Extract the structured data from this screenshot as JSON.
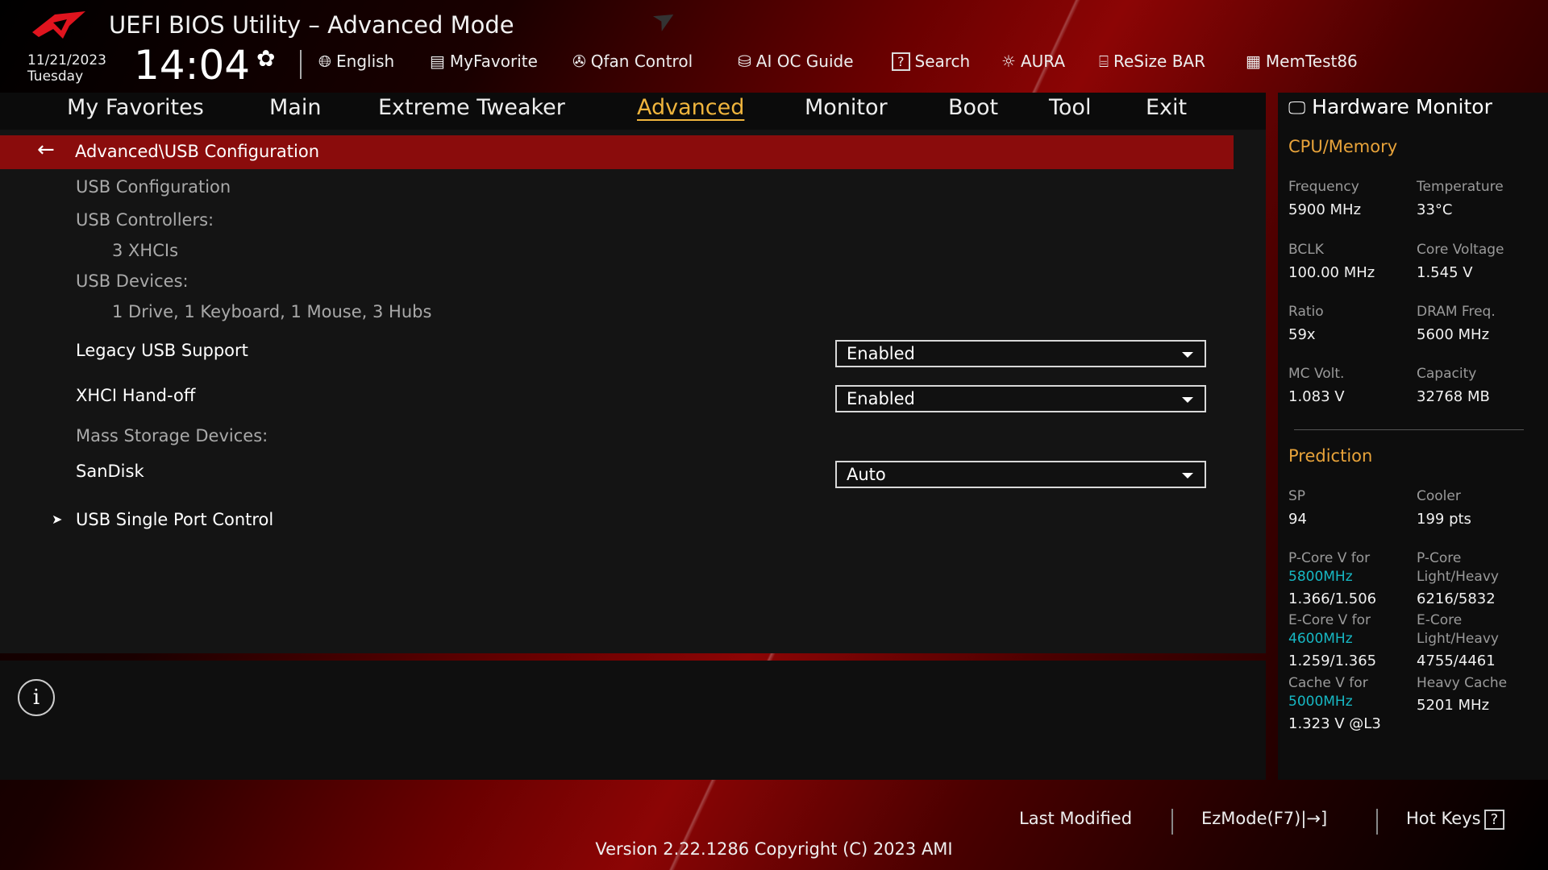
{
  "header": {
    "title": "UEFI BIOS Utility – Advanced Mode",
    "date": "11/21/2023",
    "day": "Tuesday",
    "time": "14:04"
  },
  "toolbar": [
    {
      "label": "English",
      "icon": "globe-icon"
    },
    {
      "label": "MyFavorite",
      "icon": "favorite-list-icon"
    },
    {
      "label": "Qfan Control",
      "icon": "fan-icon"
    },
    {
      "label": "AI OC Guide",
      "icon": "ai-chip-icon"
    },
    {
      "label": "Search",
      "icon": "question-box-icon"
    },
    {
      "label": "AURA",
      "icon": "aura-light-icon"
    },
    {
      "label": "ReSize BAR",
      "icon": "gpu-card-icon"
    },
    {
      "label": "MemTest86",
      "icon": "memory-icon"
    }
  ],
  "tabs": [
    "My Favorites",
    "Main",
    "Extreme Tweaker",
    "Advanced",
    "Monitor",
    "Boot",
    "Tool",
    "Exit"
  ],
  "active_tab": "Advanced",
  "breadcrumb": "Advanced\\USB Configuration",
  "items": {
    "usb_config": "USB Configuration",
    "controllers_label": "USB Controllers:",
    "controllers_value": "3 XHCIs",
    "devices_label": "USB Devices:",
    "devices_value": "1 Drive, 1 Keyboard, 1 Mouse, 3 Hubs",
    "legacy": {
      "label": "Legacy USB Support",
      "value": "Enabled"
    },
    "xhci": {
      "label": "XHCI Hand-off",
      "value": "Enabled"
    },
    "mass_label": "Mass Storage Devices:",
    "sandisk": {
      "label": "SanDisk",
      "value": "Auto"
    },
    "single_port": "USB Single Port Control"
  },
  "hw": {
    "title": "Hardware Monitor",
    "cpu_section": "CPU/Memory",
    "cpu": [
      {
        "label": "Frequency",
        "value": "5900 MHz"
      },
      {
        "label": "Temperature",
        "value": "33°C"
      },
      {
        "label": "BCLK",
        "value": "100.00 MHz"
      },
      {
        "label": "Core Voltage",
        "value": "1.545 V"
      },
      {
        "label": "Ratio",
        "value": "59x"
      },
      {
        "label": "DRAM Freq.",
        "value": "5600 MHz"
      },
      {
        "label": "MC Volt.",
        "value": "1.083 V"
      },
      {
        "label": "Capacity",
        "value": "32768 MB"
      }
    ],
    "pred_section": "Prediction",
    "sp": {
      "label": "SP",
      "value": "94"
    },
    "cooler": {
      "label": "Cooler",
      "value": "199 pts"
    },
    "pcore_v": {
      "label": "P-Core V for",
      "freq": "5800MHz",
      "value": "1.366/1.506"
    },
    "pcore_lh": {
      "label1": "P-Core",
      "label2": "Light/Heavy",
      "value": "6216/5832"
    },
    "ecore_v": {
      "label": "E-Core V for",
      "freq": "4600MHz",
      "value": "1.259/1.365"
    },
    "ecore_lh": {
      "label1": "E-Core",
      "label2": "Light/Heavy",
      "value": "4755/4461"
    },
    "cache_v": {
      "label": "Cache V for",
      "freq": "5000MHz",
      "value": "1.323 V @L3"
    },
    "heavy_cache": {
      "label": "Heavy Cache",
      "value": "5201 MHz"
    }
  },
  "footer": {
    "last_modified": "Last Modified",
    "ezmode": "EzMode(F7)|",
    "hotkeys": "Hot Keys",
    "hotkeys_icon": "?",
    "version": "Version 2.22.1286 Copyright (C) 2023 AMI"
  },
  "colors": {
    "accent": "#f0b53d",
    "breadcrumb": "#8a0c0c",
    "cyan": "#17b8c4"
  }
}
